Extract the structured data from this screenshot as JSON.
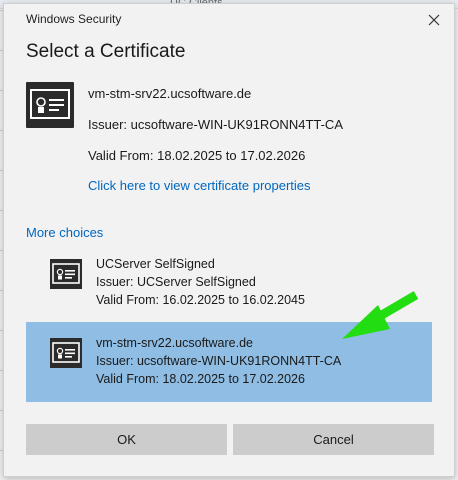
{
  "background": {
    "partial_text": "UC Clients"
  },
  "dialog": {
    "window_title": "Windows Security",
    "heading": "Select a Certificate",
    "selected_certificate": {
      "name": "vm-stm-srv22.ucsoftware.de",
      "issuer": "Issuer: ucsoftware-WIN-UK91RONN4TT-CA",
      "valid": "Valid From: 18.02.2025 to 17.02.2026",
      "properties_link": "Click here to view certificate properties",
      "icon": "certificate-icon"
    },
    "more_choices_label": "More choices",
    "choices": [
      {
        "name": "UCServer SelfSigned",
        "issuer": "Issuer: UCServer SelfSigned",
        "valid": "Valid From: 16.02.2025 to 16.02.2045",
        "selected": false,
        "icon": "certificate-icon"
      },
      {
        "name": "vm-stm-srv22.ucsoftware.de",
        "issuer": "Issuer: ucsoftware-WIN-UK91RONN4TT-CA",
        "valid": "Valid From: 18.02.2025 to 17.02.2026",
        "selected": true,
        "icon": "certificate-icon"
      }
    ],
    "buttons": {
      "ok": "OK",
      "cancel": "Cancel"
    }
  },
  "colors": {
    "link": "#0067c0",
    "selection": "#8fbde3",
    "annotation_arrow": "#22dd11"
  }
}
